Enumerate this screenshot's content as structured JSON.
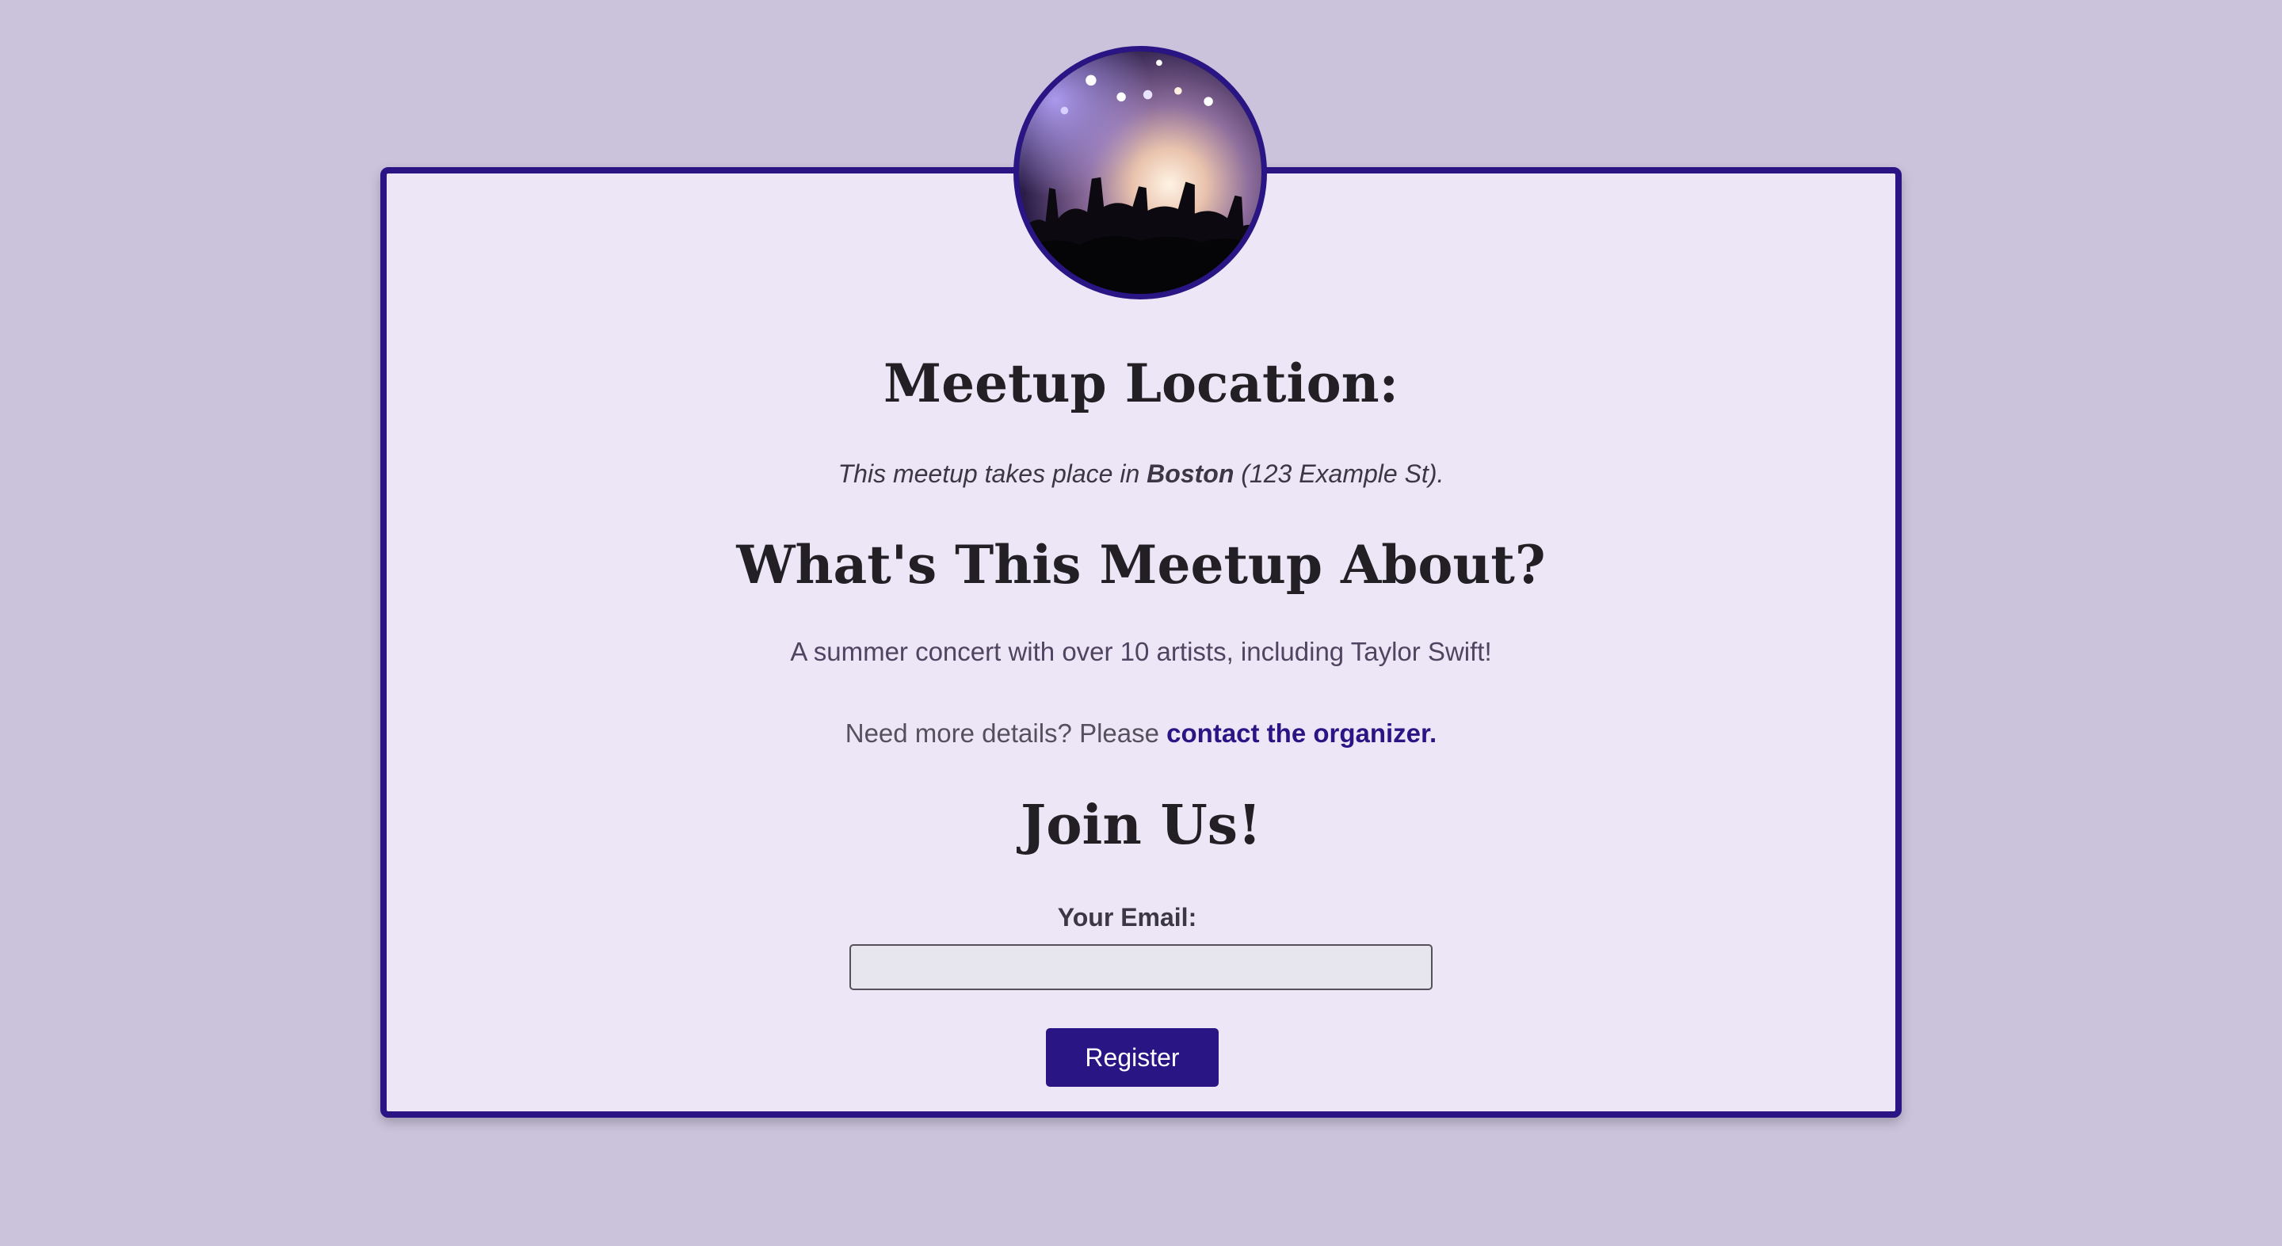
{
  "hero_image": {
    "alt": "concert crowd"
  },
  "location": {
    "heading": "Meetup Location:",
    "text_prefix": "This meetup takes place in ",
    "city": "Boston",
    "text_suffix": " (123 Example St)."
  },
  "about": {
    "heading": "What's This Meetup About?",
    "description": "A summer concert with over 10 artists, including Taylor Swift!",
    "details_prefix": "Need more details? Please ",
    "details_link": "contact the organizer."
  },
  "join": {
    "heading": "Join Us!",
    "email_label": "Your Email:",
    "email_value": "",
    "email_placeholder": "",
    "register_label": "Register"
  },
  "colors": {
    "accent": "#2a1585",
    "page_background": "#cbc3db",
    "card_background": "#ece6f6"
  }
}
